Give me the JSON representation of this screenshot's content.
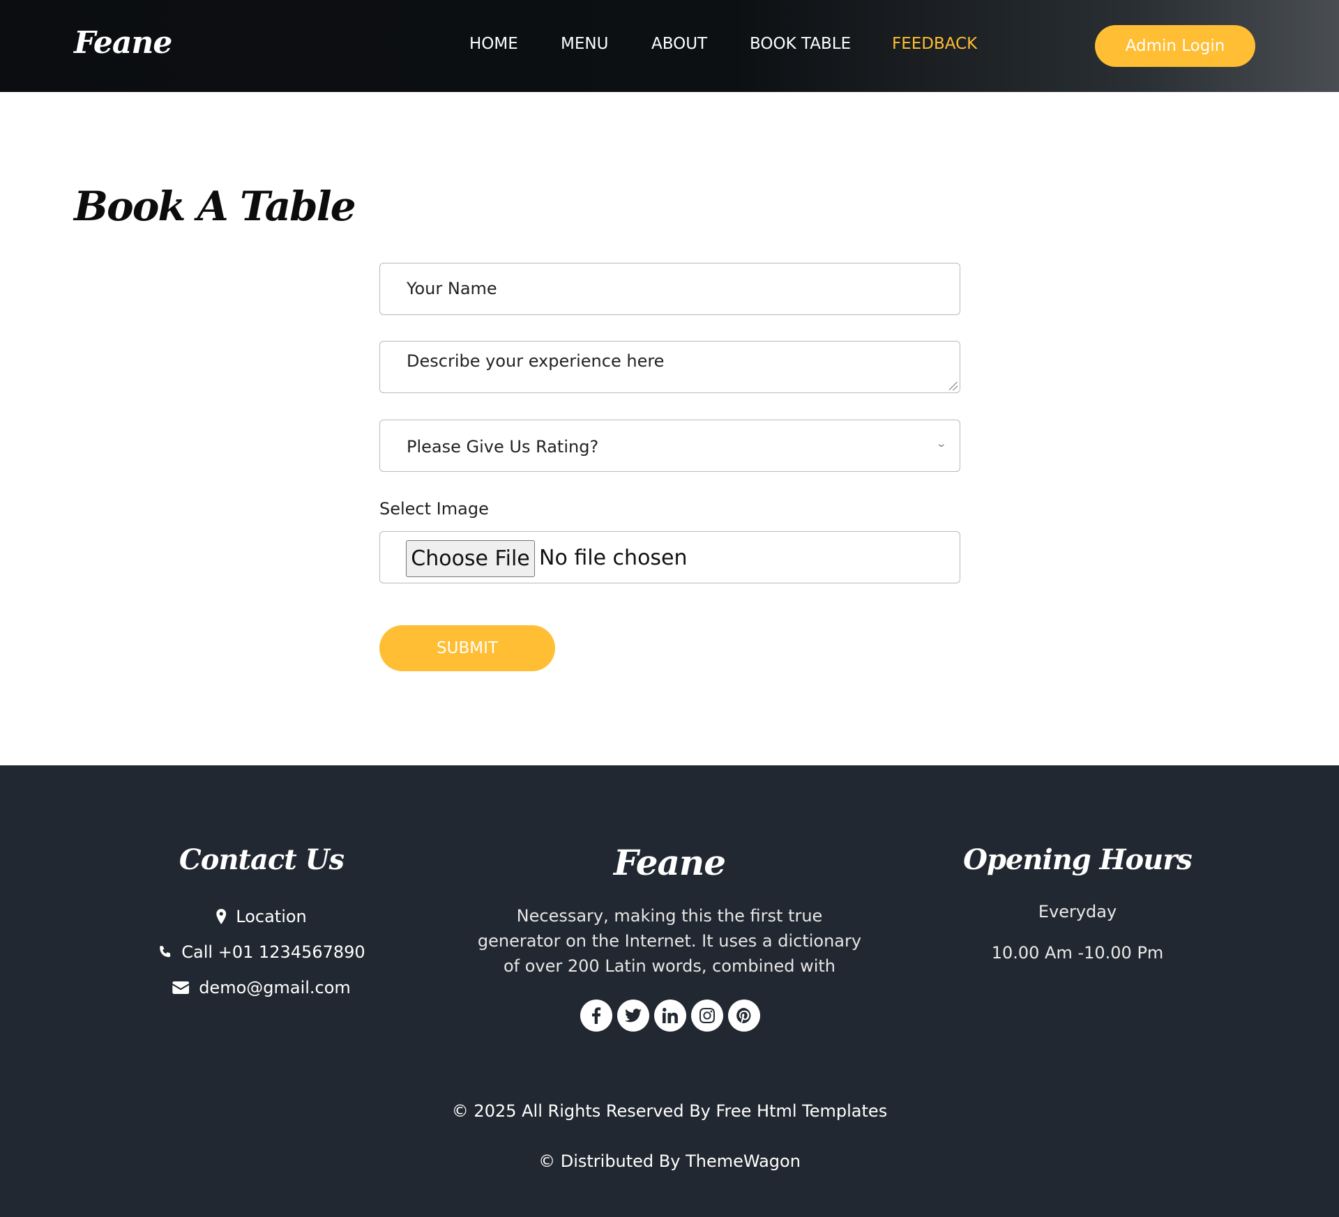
{
  "brand": "Feane",
  "nav": {
    "items": [
      "HOME",
      "MENU",
      "ABOUT",
      "BOOK TABLE",
      "FEEDBACK"
    ],
    "active_index": 4,
    "admin_label": "Admin Login"
  },
  "colors": {
    "accent": "#ffbe33",
    "footer_bg": "#222831",
    "header_bg": "#0d1013"
  },
  "form": {
    "title": "Book A Table",
    "name_placeholder": "Your Name",
    "experience_placeholder": "Describe your experience here",
    "rating_selected": "Please Give Us Rating?",
    "image_label": "Select Image",
    "file_button": "Choose File",
    "file_status": "No file chosen",
    "submit_label": "SUBMIT"
  },
  "footer": {
    "contact": {
      "title": "Contact Us",
      "location": "Location",
      "phone": "Call +01 1234567890",
      "email": "demo@gmail.com"
    },
    "about": {
      "brand": "Feane",
      "text": "Necessary, making this the first true generator on the Internet. It uses a dictionary of over 200 Latin words, combined with",
      "social_icons": [
        "facebook-icon",
        "twitter-icon",
        "linkedin-icon",
        "instagram-icon",
        "pinterest-icon"
      ]
    },
    "hours": {
      "title": "Opening Hours",
      "days": "Everyday",
      "time": "10.00 Am -10.00 Pm"
    },
    "copyright": "© 2025 All Rights Reserved By Free Html Templates",
    "distributed": "© Distributed By ThemeWagon"
  }
}
